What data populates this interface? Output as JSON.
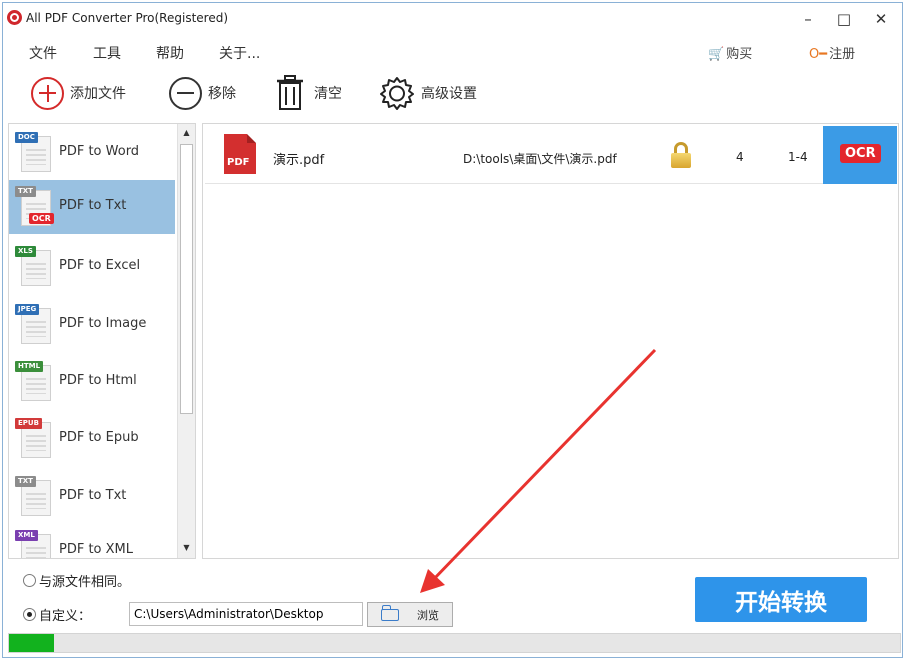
{
  "window": {
    "title": "All PDF Converter Pro(Registered)",
    "controls": {
      "minimize": "–",
      "maximize": "□",
      "close": "✕"
    }
  },
  "menu": [
    "文件",
    "工具",
    "帮助",
    "关于..."
  ],
  "account": {
    "buy": "购买",
    "register": "注册"
  },
  "toolbar": {
    "add": "添加文件",
    "remove": "移除",
    "clear": "清空",
    "advanced": "高级设置"
  },
  "converters": [
    {
      "label": "PDF to Word",
      "tag": "DOC",
      "tag_color": "#2f6fb5",
      "selected": false
    },
    {
      "label": "PDF to Txt",
      "tag": "TXT",
      "tag_color": "#8c8c8c",
      "selected": true,
      "ocr": "OCR"
    },
    {
      "label": "PDF to Excel",
      "tag": "XLS",
      "tag_color": "#2e8a3a",
      "selected": false
    },
    {
      "label": "PDF to Image",
      "tag": "JPEG",
      "tag_color": "#2f6fb5",
      "selected": false
    },
    {
      "label": "PDF to Html",
      "tag": "HTML",
      "tag_color": "#3b8f3b",
      "selected": false
    },
    {
      "label": "PDF to Epub",
      "tag": "EPUB",
      "tag_color": "#d23a3a",
      "selected": false
    },
    {
      "label": "PDF to Txt",
      "tag": "TXT",
      "tag_color": "#8c8c8c",
      "selected": false
    },
    {
      "label": "PDF to XML",
      "tag": "XML",
      "tag_color": "#7a3fb0",
      "selected": false
    }
  ],
  "files": [
    {
      "icon_text": "PDF",
      "name": "演示.pdf",
      "path": "D:\\tools\\桌面\\文件\\演示.pdf",
      "pages": "4",
      "range": "1-4",
      "ocr": "OCR"
    }
  ],
  "output": {
    "same_as_source": "与源文件相同。",
    "custom_label": "自定义：",
    "custom_path": "C:\\Users\\Administrator\\Desktop",
    "browse": "浏览",
    "selected": "custom"
  },
  "start_button": "开始转换",
  "progress": 0.05,
  "colors": {
    "accent": "#2e94ea",
    "selected_row": "#99c1e1",
    "progress": "#12b21e",
    "annotation": "#e8332f"
  }
}
